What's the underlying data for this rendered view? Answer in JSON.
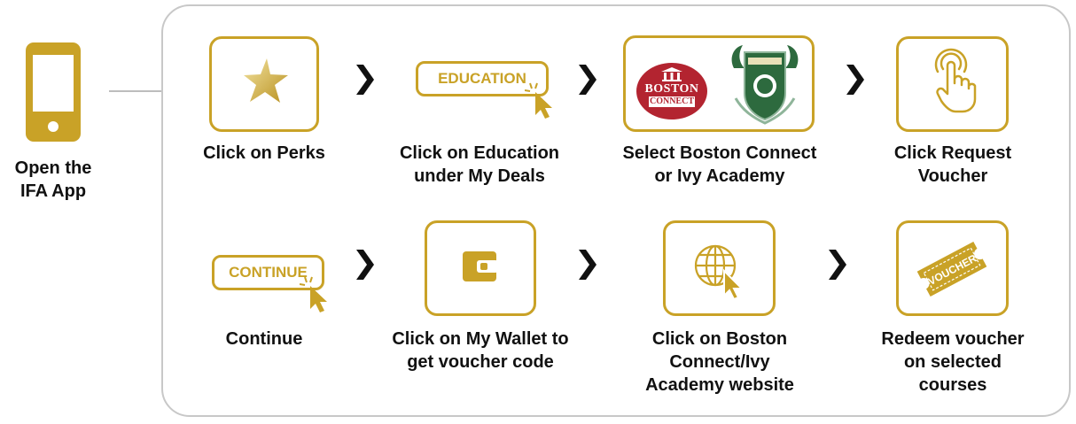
{
  "start": {
    "label_line1": "Open the",
    "label_line2": "IFA App"
  },
  "steps": [
    {
      "id": "perks",
      "line1": "Click on Perks",
      "line2": ""
    },
    {
      "id": "education",
      "line1": "Click on Education",
      "line2": "under My Deals",
      "pill": "EDUCATION"
    },
    {
      "id": "select",
      "line1": "Select Boston Connect",
      "line2": "or Ivy Academy"
    },
    {
      "id": "request",
      "line1": "Click Request",
      "line2": "Voucher"
    },
    {
      "id": "continue",
      "line1": "Continue",
      "line2": "",
      "pill": "CONTINUE"
    },
    {
      "id": "wallet",
      "line1": "Click on My Wallet to",
      "line2": "get voucher code"
    },
    {
      "id": "website",
      "line1": "Click on Boston",
      "line2": "Connect/Ivy",
      "line3": "Academy website"
    },
    {
      "id": "redeem",
      "line1": "Redeem voucher",
      "line2": "on selected",
      "line3": "courses"
    }
  ],
  "logos": {
    "boston_name": "BOSTON",
    "boston_sub": "CONNECT",
    "voucher_text": "VOUCHER"
  },
  "colors": {
    "gold": "#c9a227",
    "boston_red": "#b32430",
    "ivy_green": "#2d6a3e"
  },
  "icons": [
    "phone-icon",
    "star-icon",
    "cursor-icon",
    "tap-hand-icon",
    "wallet-icon",
    "globe-icon",
    "voucher-ticket-icon",
    "chevron-right-icon"
  ]
}
